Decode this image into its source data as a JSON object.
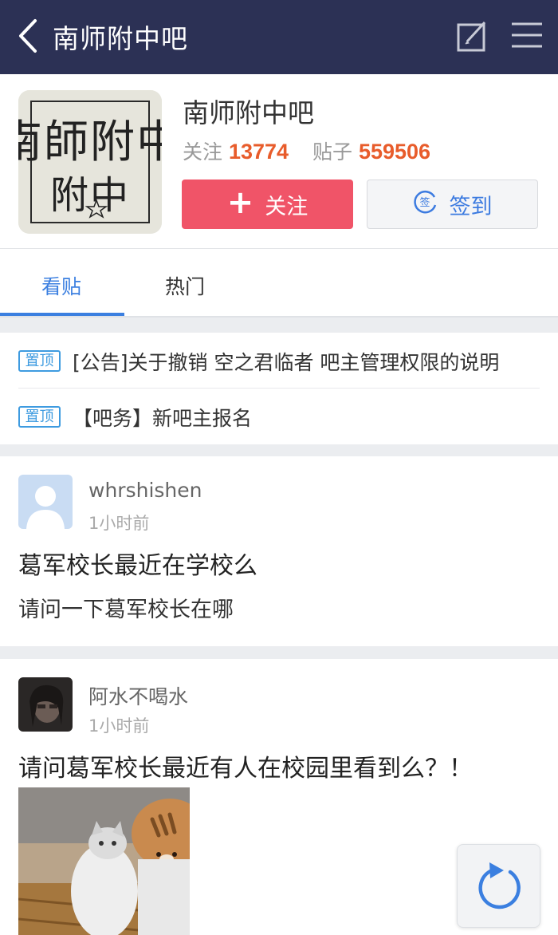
{
  "topbar": {
    "title": "南师附中吧",
    "back_icon": "chevron-left-icon",
    "edit_icon": "edit-icon",
    "menu_icon": "menu-icon",
    "bg_color": "#2c3155"
  },
  "forum": {
    "name": "南师附中吧",
    "logo_text": "南師附中",
    "follow_label": "关注",
    "follow_count": "13774",
    "posts_label": "贴子",
    "posts_count": "559506",
    "follow_button": "关注",
    "sign_button": "签到",
    "sign_icon_char": "签",
    "accent_red": "#f05468",
    "accent_blue": "#3b7fe0",
    "count_color": "#e85c2b"
  },
  "tabs": [
    {
      "label": "看贴",
      "active": true
    },
    {
      "label": "热门",
      "active": false
    }
  ],
  "pinned": [
    {
      "badge": "置顶",
      "text": "[公告]关于撤销 空之君临者 吧主管理权限的说明"
    },
    {
      "badge": "置顶",
      "text": "【吧务】新吧主报名"
    }
  ],
  "posts": [
    {
      "user": "whrshishen",
      "time": "1小时前",
      "title": "葛军校长最近在学校么",
      "body": "请问一下葛军校长在哪"
    },
    {
      "user": "阿水不喝水",
      "time": "1小时前",
      "title": "请问葛军校长最近有人在校园里看到么？！"
    }
  ],
  "floating": {
    "refresh_icon": "refresh-icon"
  }
}
